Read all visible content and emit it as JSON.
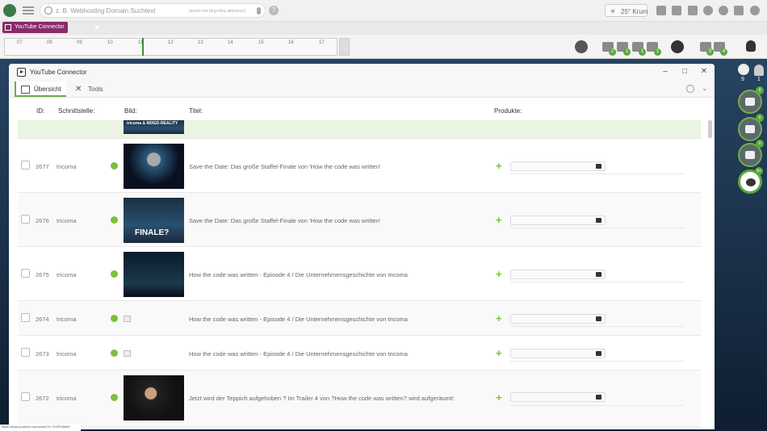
{
  "topbar": {
    "search_placeholder": "z. B. Webhosting Domain Suchtext",
    "search_hint": "(suche mit Strg+Strg aktivieren)",
    "weather": "25° Krum"
  },
  "apptab": {
    "label": "YouTube Connector"
  },
  "timeline": {
    "ticks": [
      "07",
      "08",
      "09",
      "10",
      "11",
      "12",
      "13",
      "14",
      "15",
      "16",
      "17"
    ]
  },
  "status_badges": [
    "2",
    "1",
    "1",
    "1",
    "0",
    "4"
  ],
  "sidebar": {
    "avatar_count": "9",
    "bell_count": "1",
    "bubbles": [
      "0",
      "0",
      "0",
      "9+"
    ]
  },
  "window": {
    "title": "YouTube Connector",
    "tabs": [
      {
        "label": "Übersicht"
      },
      {
        "label": "Tools"
      }
    ]
  },
  "table": {
    "headers": {
      "id": "ID:",
      "iface": "Schnittstelle:",
      "image": "Bild:",
      "title": "Titel:",
      "products": "Produkte:"
    },
    "partial_thumb_text": "tricoma & MIXED-REALITY",
    "rows": [
      {
        "id": "2677",
        "iface": "tricoma",
        "title": "Save the Date: Das große Staffel-Finale von 'How the code was written'"
      },
      {
        "id": "2676",
        "iface": "tricoma",
        "title": "Save the Date: Das große Staffel-Finale von 'How the code was written'",
        "thumb_text": "FINALE?"
      },
      {
        "id": "2675",
        "iface": "tricoma",
        "title": "How the code was written - Episode 4 / Die Unternehmensgeschichte von tricoma"
      },
      {
        "id": "2674",
        "iface": "tricoma",
        "title": "How the code was written - Episode 4 / Die Unternehmensgeschichte von tricoma"
      },
      {
        "id": "2673",
        "iface": "tricoma",
        "title": "How the code was written - Episode 4 / Die Unternehmensgeschichte von tricoma"
      },
      {
        "id": "2672",
        "iface": "tricoma",
        "title": "Jetzt wird der Teppich aufgehoben ? Im Trailer 4 von ?How the code was written? wird aufgeräumt!"
      }
    ]
  },
  "statusbar": {
    "url": "https://www.youtube.com/watch?v=YhZFh8dt99"
  }
}
